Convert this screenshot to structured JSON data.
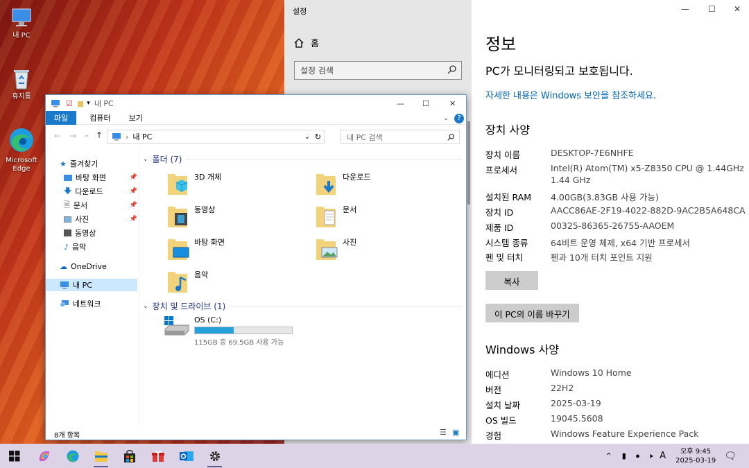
{
  "desktop": {
    "icons": [
      {
        "label": "내 PC",
        "icon": "computer-icon"
      },
      {
        "label": "휴지통",
        "icon": "recycle-bin-icon"
      },
      {
        "label": "Microsoft Edge",
        "icon": "edge-icon"
      }
    ]
  },
  "settings": {
    "title": "설정",
    "home": "홈",
    "search_placeholder": "설정 검색",
    "heading": "정보",
    "protection_status": "PC가 모니터링되고 보호됩니다.",
    "security_link": "자세한 내용은 Windows 보안을 참조하세요.",
    "device_specs_title": "장치 사양",
    "device_specs": [
      {
        "key": "장치 이름",
        "value": "DESKTOP-7E6NHFE"
      },
      {
        "key": "프로세서",
        "value": "Intel(R) Atom(TM) x5-Z8350  CPU @ 1.44GHz",
        "value2": "1.44 GHz"
      },
      {
        "key": "설치된 RAM",
        "value": "4.00GB(3.83GB 사용 가능)"
      },
      {
        "key": "장치 ID",
        "value": "AACC86AE-2F19-4022-882D-9AC2B5A648CA"
      },
      {
        "key": "제품 ID",
        "value": "00325-86365-26755-AAOEM"
      },
      {
        "key": "시스템 종류",
        "value": "64비트 운영 체제, x64 기반 프로세서"
      },
      {
        "key": "펜 및 터치",
        "value": "펜과 10개 터치 포인트 지원"
      }
    ],
    "copy_button": "복사",
    "rename_button": "이 PC의 이름 바꾸기",
    "windows_specs_title": "Windows 사양",
    "windows_specs": [
      {
        "key": "에디션",
        "value": "Windows 10 Home"
      },
      {
        "key": "버전",
        "value": "22H2"
      },
      {
        "key": "설치 날짜",
        "value": "2025-03-19"
      },
      {
        "key": "OS 빌드",
        "value": "19045.5608"
      },
      {
        "key": "경험",
        "value": "Windows Feature Experience Pack"
      }
    ]
  },
  "explorer": {
    "title": "내 PC",
    "ribbon_tabs": [
      "파일",
      "컴퓨터",
      "보기"
    ],
    "address": "내 PC",
    "search_placeholder": "내 PC 검색",
    "quick_access": "즐겨찾기",
    "nav_items": [
      {
        "label": "바탕 화면",
        "pinned": true
      },
      {
        "label": "다운로드",
        "pinned": true
      },
      {
        "label": "문서",
        "pinned": true
      },
      {
        "label": "사진",
        "pinned": true
      },
      {
        "label": "동영상",
        "pinned": false
      },
      {
        "label": "음악",
        "pinned": false
      }
    ],
    "onedrive": "OneDrive",
    "this_pc": "내 PC",
    "network": "네트워크",
    "folders_group": "폴더 (7)",
    "folders": [
      "3D 개체",
      "다운로드",
      "동영상",
      "문서",
      "바탕 화면",
      "사진",
      "음악"
    ],
    "drives_group": "장치 및 드라이브 (1)",
    "drive": {
      "name": "OS (C:)",
      "detail": "115GB 중 69.5GB 사용 가능",
      "used_fraction": 0.4
    },
    "status": "8개 항목"
  },
  "taskbar": {
    "apps": [
      "start-icon",
      "copilot-icon",
      "edge-icon",
      "file-explorer-icon",
      "store-icon",
      "gift-icon",
      "outlook-icon",
      "settings-icon"
    ],
    "ime": "A",
    "time": "오후 9:45",
    "date": "2025-03-19"
  }
}
